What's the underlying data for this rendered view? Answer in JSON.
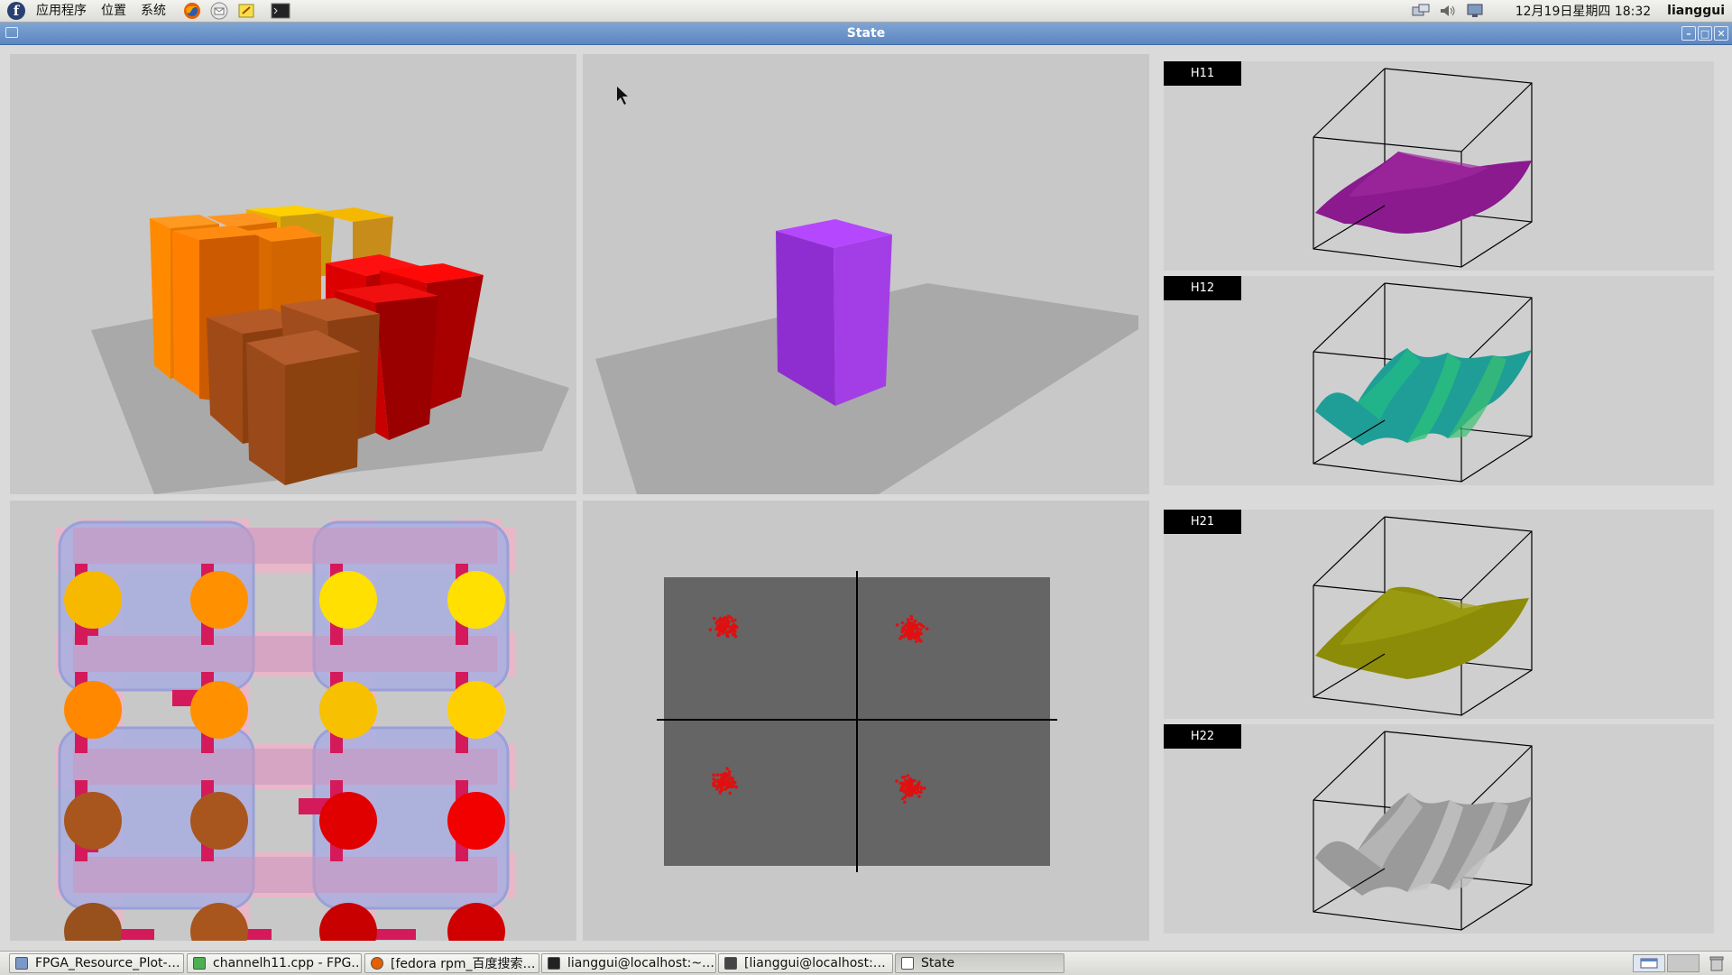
{
  "top_panel": {
    "logo_glyph": "f",
    "menus": [
      "应用程序",
      "位置",
      "系统"
    ],
    "launchers": [
      "firefox-icon",
      "mail-icon",
      "notes-icon",
      "terminal-icon"
    ],
    "tray_icons": [
      "network-icon",
      "volume-icon",
      "monitor-icon"
    ],
    "clock": "12月19日星期四 18:32",
    "user": "lianggui"
  },
  "window": {
    "title": "State",
    "controls": {
      "minimize": "–",
      "maximize": "□",
      "close": "✕"
    }
  },
  "panels": {
    "h11": {
      "label": "H11",
      "surface_color": "#8a1a8e"
    },
    "h12": {
      "label": "H12",
      "surface_color": "#1ea890"
    },
    "h21": {
      "label": "H21",
      "surface_color": "#8a8a10"
    },
    "h22": {
      "label": "H22",
      "surface_color": "#9a9a9a"
    }
  },
  "colors": {
    "viewport_bg": "#c8c8c8",
    "floor": "#a9a9a9",
    "orange": "#ff8c00",
    "gold": "#f5b800",
    "red": "#dd0000",
    "brown": "#a0522d",
    "purple": "#a335e0",
    "scatter_points": "#e01010"
  },
  "taskbar": {
    "items": [
      {
        "label": "FPGA_Resource_Plot-…",
        "icon": "folder-icon"
      },
      {
        "label": "channelh11.cpp - FPG…",
        "icon": "editor-icon"
      },
      {
        "label": "[fedora rpm_百度搜索…",
        "icon": "firefox-icon"
      },
      {
        "label": "lianggui@localhost:~…",
        "icon": "terminal-icon"
      },
      {
        "label": "[lianggui@localhost:…",
        "icon": "terminal-icon"
      },
      {
        "label": "State",
        "icon": "window-icon",
        "active": true
      }
    ]
  }
}
